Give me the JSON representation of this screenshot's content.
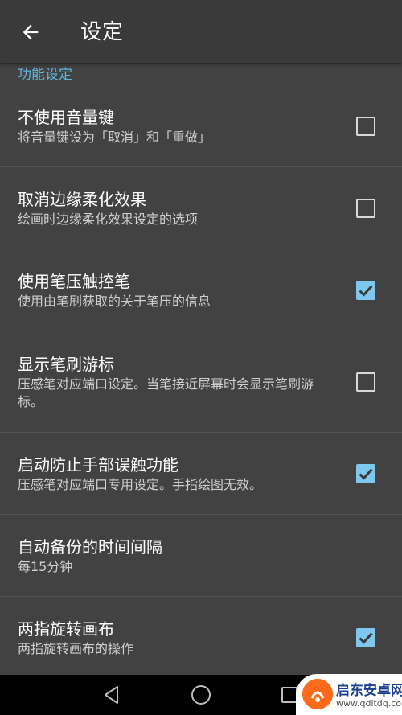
{
  "header": {
    "title": "设定"
  },
  "section": {
    "label": "功能设定"
  },
  "items": [
    {
      "title": "不使用音量键",
      "subtitle": "将音量键设为「取消」和「重做」",
      "checked": false
    },
    {
      "title": "取消边缘柔化效果",
      "subtitle": "绘画时边缘柔化效果设定的选项",
      "checked": false
    },
    {
      "title": "使用笔压触控笔",
      "subtitle": "使用由笔刷获取的关于笔压的信息",
      "checked": true
    },
    {
      "title": "显示笔刷游标",
      "subtitle": "压感笔对应端口设定。当笔接近屏幕时会显示笔刷游标。",
      "checked": false
    },
    {
      "title": "启动防止手部误触功能",
      "subtitle": "压感笔对应端口专用设定。手指绘图无效。",
      "checked": true
    },
    {
      "title": "自动备份的时间间隔",
      "subtitle": "每15分钟",
      "checked": null
    },
    {
      "title": "两指旋转画布",
      "subtitle": "两指旋转画布的操作",
      "checked": true
    }
  ],
  "watermark": {
    "name": "启东安卓网",
    "url": "www.qdltdq.com"
  },
  "colors": {
    "accent": "#5fb6dc",
    "checkbox_on": "#7ec8ee",
    "background": "#424242"
  }
}
